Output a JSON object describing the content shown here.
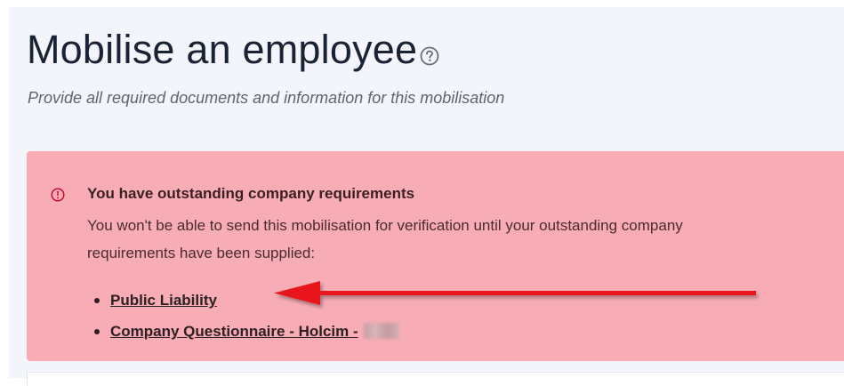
{
  "header": {
    "title": "Mobilise an employee",
    "subtitle": "Provide all required documents and information for this mobilisation"
  },
  "alert": {
    "title": "You have outstanding company requirements",
    "text": "You won't be able to send this mobilisation for verification until your outstanding company requirements have been supplied:",
    "requirements": [
      {
        "label": "Public Liability"
      },
      {
        "label": "Company Questionnaire - Holcim -"
      }
    ]
  },
  "colors": {
    "alert_bg": "#f8adb6",
    "alert_icon": "#c8102e",
    "annotation_arrow": "#e8141e",
    "title_text": "#1a2236"
  },
  "icons": {
    "help": "question-circle-icon",
    "alert": "exclamation-circle-icon"
  }
}
